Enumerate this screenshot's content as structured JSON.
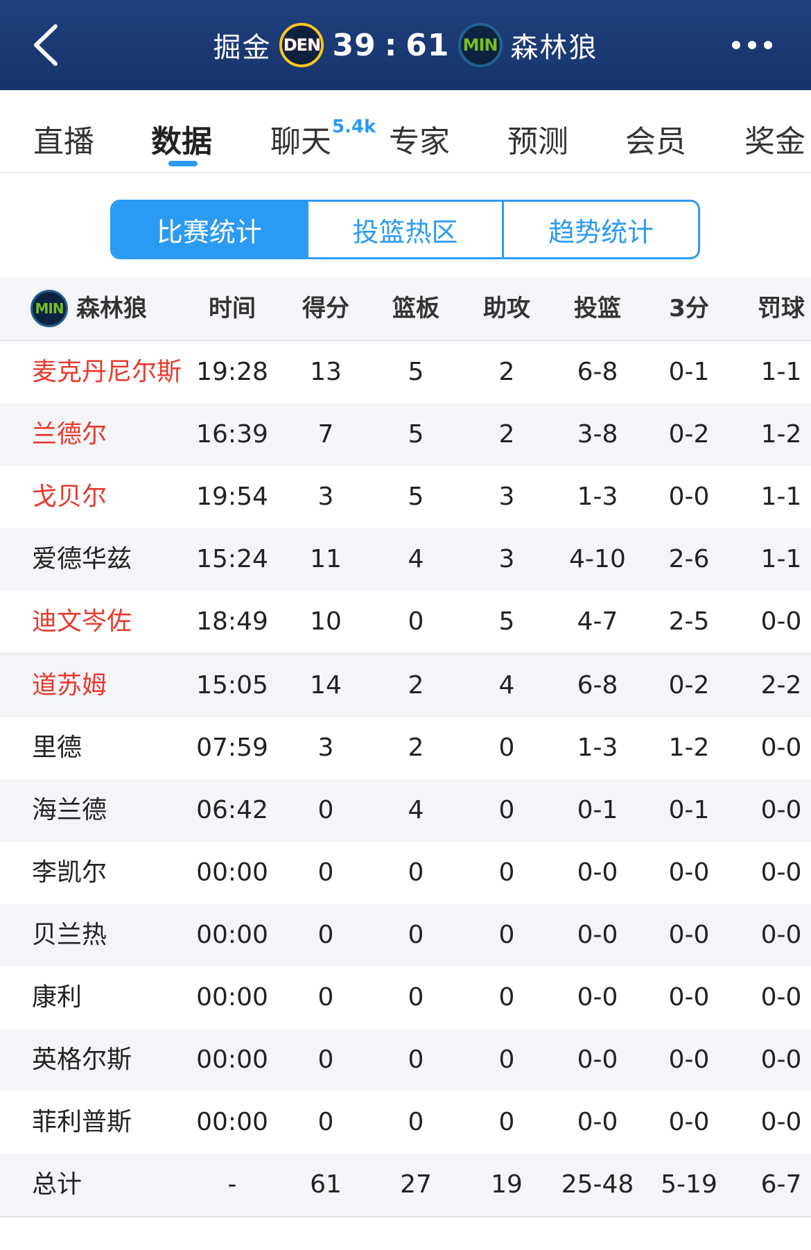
{
  "header": {
    "home_team": "掘金",
    "home_logo": "DEN",
    "home_score": "39",
    "separator": ":",
    "away_score": "61",
    "away_logo": "MIN",
    "away_team": "森林狼",
    "back_icon": "chevron-left-icon",
    "more_icon": "more-dots-icon"
  },
  "tabs": [
    {
      "label": "直播"
    },
    {
      "label": "数据"
    },
    {
      "label": "聊天",
      "badge": "5.4k"
    },
    {
      "label": "专家"
    },
    {
      "label": "预测"
    },
    {
      "label": "会员"
    },
    {
      "label": "奖金"
    }
  ],
  "segments": [
    "比赛统计",
    "投篮热区",
    "趋势统计"
  ],
  "table": {
    "team_logo": "MIN",
    "team_name": "森林狼",
    "columns": [
      "时间",
      "得分",
      "篮板",
      "助攻",
      "投篮",
      "3分",
      "罚球"
    ],
    "rows": [
      {
        "name": "麦克丹尼尔斯",
        "starter": true,
        "time": "19:28",
        "pts": "13",
        "reb": "5",
        "ast": "2",
        "fg": "6-8",
        "tp": "0-1",
        "ft": "1-1"
      },
      {
        "name": "兰德尔",
        "starter": true,
        "time": "16:39",
        "pts": "7",
        "reb": "5",
        "ast": "2",
        "fg": "3-8",
        "tp": "0-2",
        "ft": "1-2"
      },
      {
        "name": "戈贝尔",
        "starter": true,
        "time": "19:54",
        "pts": "3",
        "reb": "5",
        "ast": "3",
        "fg": "1-3",
        "tp": "0-0",
        "ft": "1-1"
      },
      {
        "name": "爱德华兹",
        "starter": false,
        "time": "15:24",
        "pts": "11",
        "reb": "4",
        "ast": "3",
        "fg": "4-10",
        "tp": "2-6",
        "ft": "1-1"
      },
      {
        "name": "迪文岑佐",
        "starter": true,
        "time": "18:49",
        "pts": "10",
        "reb": "0",
        "ast": "5",
        "fg": "4-7",
        "tp": "2-5",
        "ft": "0-0"
      },
      {
        "name": "道苏姆",
        "starter": true,
        "time": "15:05",
        "pts": "14",
        "reb": "2",
        "ast": "4",
        "fg": "6-8",
        "tp": "0-2",
        "ft": "2-2"
      },
      {
        "name": "里德",
        "starter": false,
        "time": "07:59",
        "pts": "3",
        "reb": "2",
        "ast": "0",
        "fg": "1-3",
        "tp": "1-2",
        "ft": "0-0"
      },
      {
        "name": "海兰德",
        "starter": false,
        "time": "06:42",
        "pts": "0",
        "reb": "4",
        "ast": "0",
        "fg": "0-1",
        "tp": "0-1",
        "ft": "0-0"
      },
      {
        "name": "李凯尔",
        "starter": false,
        "time": "00:00",
        "pts": "0",
        "reb": "0",
        "ast": "0",
        "fg": "0-0",
        "tp": "0-0",
        "ft": "0-0"
      },
      {
        "name": "贝兰热",
        "starter": false,
        "time": "00:00",
        "pts": "0",
        "reb": "0",
        "ast": "0",
        "fg": "0-0",
        "tp": "0-0",
        "ft": "0-0"
      },
      {
        "name": "康利",
        "starter": false,
        "time": "00:00",
        "pts": "0",
        "reb": "0",
        "ast": "0",
        "fg": "0-0",
        "tp": "0-0",
        "ft": "0-0"
      },
      {
        "name": "英格尔斯",
        "starter": false,
        "time": "00:00",
        "pts": "0",
        "reb": "0",
        "ast": "0",
        "fg": "0-0",
        "tp": "0-0",
        "ft": "0-0"
      },
      {
        "name": "菲利普斯",
        "starter": false,
        "time": "00:00",
        "pts": "0",
        "reb": "0",
        "ast": "0",
        "fg": "0-0",
        "tp": "0-0",
        "ft": "0-0"
      }
    ],
    "total": {
      "name": "总计",
      "time": "-",
      "pts": "61",
      "reb": "27",
      "ast": "19",
      "fg": "25-48",
      "tp": "5-19",
      "ft": "6-7"
    }
  },
  "colors": {
    "header_bg": "#1f3f7d",
    "accent": "#2b9af3",
    "starter_text": "#e8392c",
    "row_alt": "#f4f5f8"
  }
}
